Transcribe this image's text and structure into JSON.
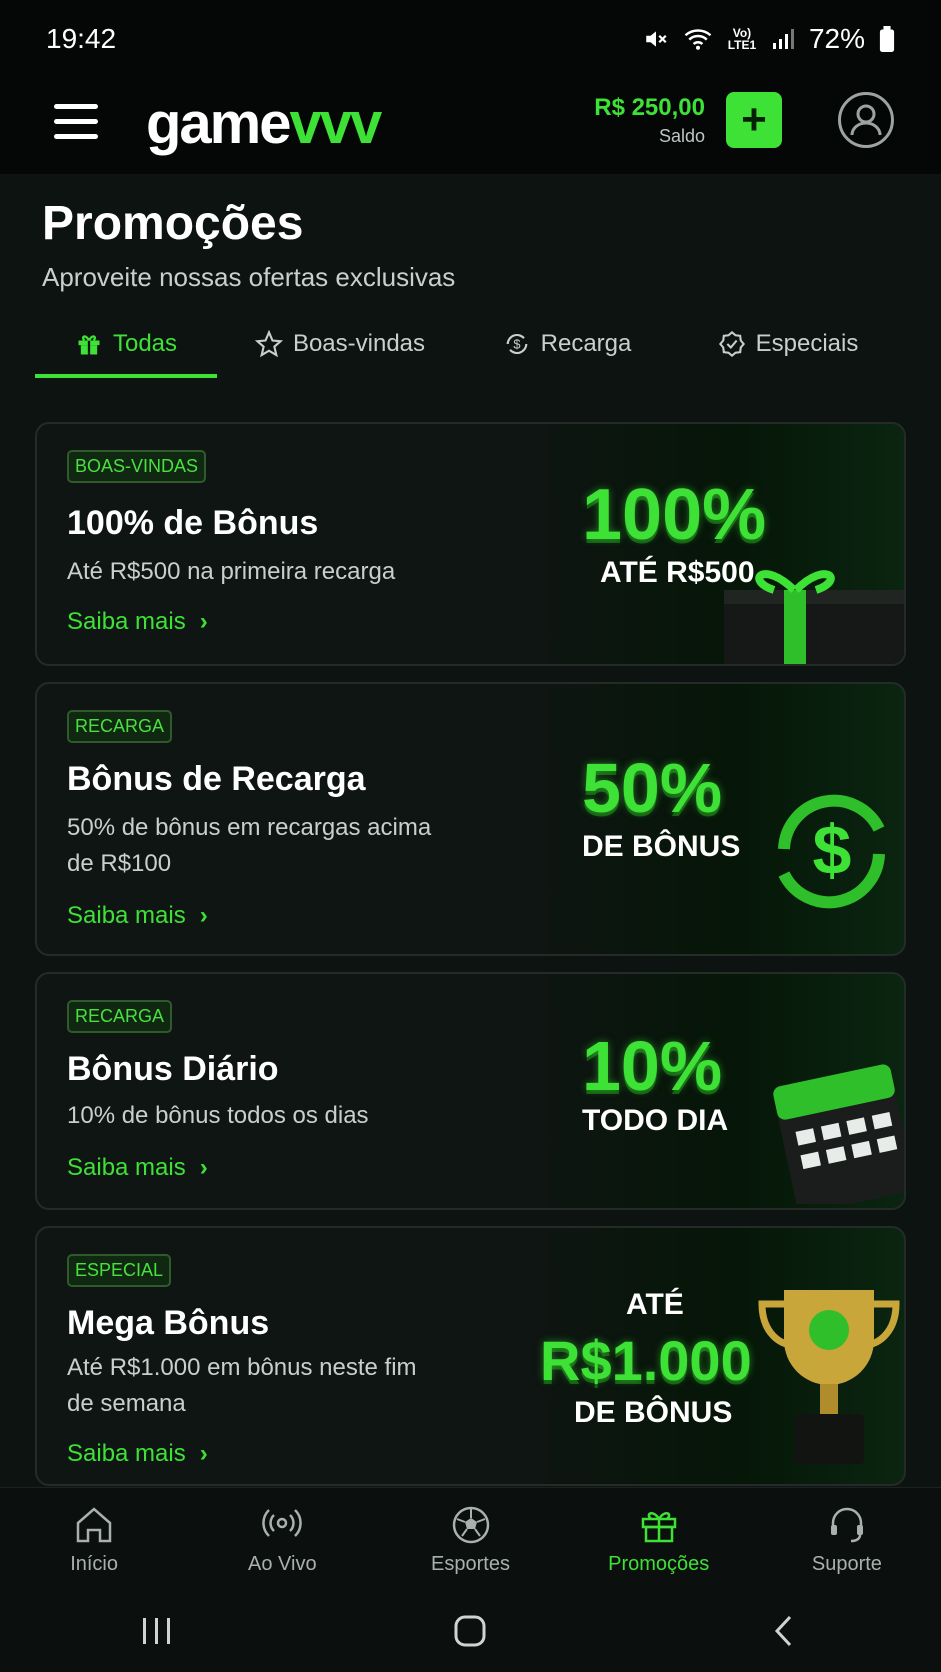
{
  "status_bar": {
    "time": "19:42",
    "battery": "72%",
    "network": "Vo) LTE1"
  },
  "header": {
    "logo_left": "game",
    "logo_right": "vvv",
    "balance": "R$ 250,00",
    "balance_label": "Saldo",
    "deposit_symbol": "+"
  },
  "page": {
    "title": "Promoções",
    "subtitle": "Aproveite nossas ofertas exclusivas"
  },
  "tabs": [
    {
      "label": "Todas",
      "icon": "gift-icon",
      "active": true
    },
    {
      "label": "Boas-vindas",
      "icon": "star-icon"
    },
    {
      "label": "Recarga",
      "icon": "refresh-dollar-icon"
    },
    {
      "label": "Especiais",
      "icon": "badge-check-icon"
    }
  ],
  "promos": [
    {
      "badge": "BOAS-VINDAS",
      "title": "100% de Bônus",
      "desc": "Até R$500 na primeira recarga",
      "more": "Saiba mais",
      "art_big": "100%",
      "art_small": "ATÉ R$500"
    },
    {
      "badge": "RECARGA",
      "title": "Bônus de Recarga",
      "desc": "50% de bônus em recargas acima de R$100",
      "more": "Saiba mais",
      "art_big": "50%",
      "art_small": "DE BÔNUS"
    },
    {
      "badge": "RECARGA",
      "title": "Bônus Diário",
      "desc": "10% de bônus todos os dias",
      "more": "Saiba mais",
      "art_big": "10%",
      "art_small": "TODO DIA"
    },
    {
      "badge": "ESPECIAL",
      "title": "Mega Bônus",
      "desc": "Até R$1.000 em bônus neste fim de semana",
      "more": "Saiba mais",
      "art_top": "ATÉ",
      "art_big": "R$1.000",
      "art_small": "DE BÔNUS"
    }
  ],
  "bottom_nav": [
    {
      "label": "Início",
      "icon": "home-icon"
    },
    {
      "label": "Ao Vivo",
      "icon": "live-icon"
    },
    {
      "label": "Esportes",
      "icon": "soccer-ball-icon"
    },
    {
      "label": "Promoções",
      "icon": "gift-icon",
      "active": true
    },
    {
      "label": "Suporte",
      "icon": "headset-icon"
    }
  ],
  "colors": {
    "accent": "#3ee135",
    "background": "#0c1311"
  }
}
